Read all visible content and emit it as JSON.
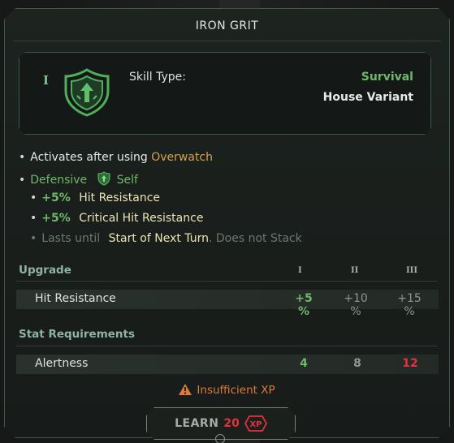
{
  "title": "IRON GRIT",
  "header": {
    "tier": "I",
    "skill_type_label": "Skill Type:",
    "skill_type_value": "Survival",
    "variant": "House Variant",
    "icon": "shield-arrow-icon"
  },
  "effects": {
    "activation_prefix": "Activates after using",
    "activation_trigger": "Overwatch",
    "category": "Defensive",
    "target": "Self",
    "bonus1_value": "+5%",
    "bonus1_label": "Hit Resistance",
    "bonus2_value": "+5%",
    "bonus2_label": "Critical Hit Resistance",
    "duration_prefix": "Lasts until",
    "duration_value": "Start of Next Turn",
    "duration_suffix": ". Does not Stack"
  },
  "upgrade": {
    "heading": "Upgrade",
    "tiers": [
      "I",
      "II",
      "III"
    ],
    "row_label": "Hit Resistance",
    "values": [
      "+5 %",
      "+10 %",
      "+15 %"
    ]
  },
  "requirements": {
    "heading": "Stat Requirements",
    "row_label": "Alertness",
    "values": [
      "4",
      "8",
      "12"
    ]
  },
  "warning": "Insufficient XP",
  "learn": {
    "label": "LEARN",
    "cost": "20",
    "currency": "XP"
  },
  "colors": {
    "accent_green": "#6fb86a",
    "accent_orange": "#d9a04e",
    "danger_red": "#e0333d",
    "warning_orange": "#e07a38"
  }
}
